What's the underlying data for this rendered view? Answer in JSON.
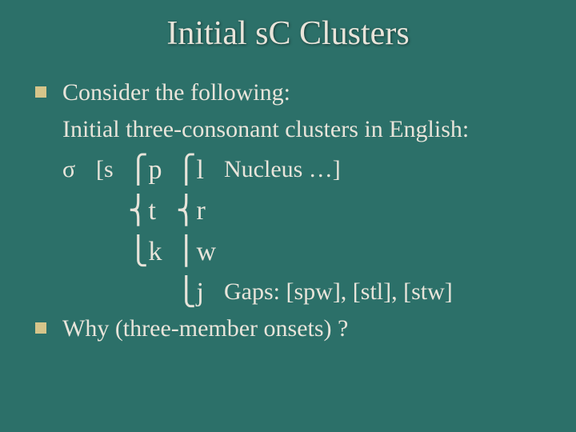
{
  "title": "Initial sC Clusters",
  "bullet1": {
    "line1": "Consider the following:",
    "line2": "Initial three-consonant clusters in English:"
  },
  "table": {
    "sigma": "σ",
    "open": "[s",
    "rows": [
      {
        "c1": "⎧p",
        "c2": "⎧l",
        "rest": "Nucleus   …]"
      },
      {
        "c1": "⎨t",
        "c2": "⎨r",
        "rest": ""
      },
      {
        "c1": "⎩k",
        "c2": "⎪w",
        "rest": ""
      },
      {
        "c1": "",
        "c2": "⎩j",
        "rest": "Gaps: [spw], [stl], [stw]"
      }
    ]
  },
  "bullet2": "Why (three-member onsets) ?"
}
